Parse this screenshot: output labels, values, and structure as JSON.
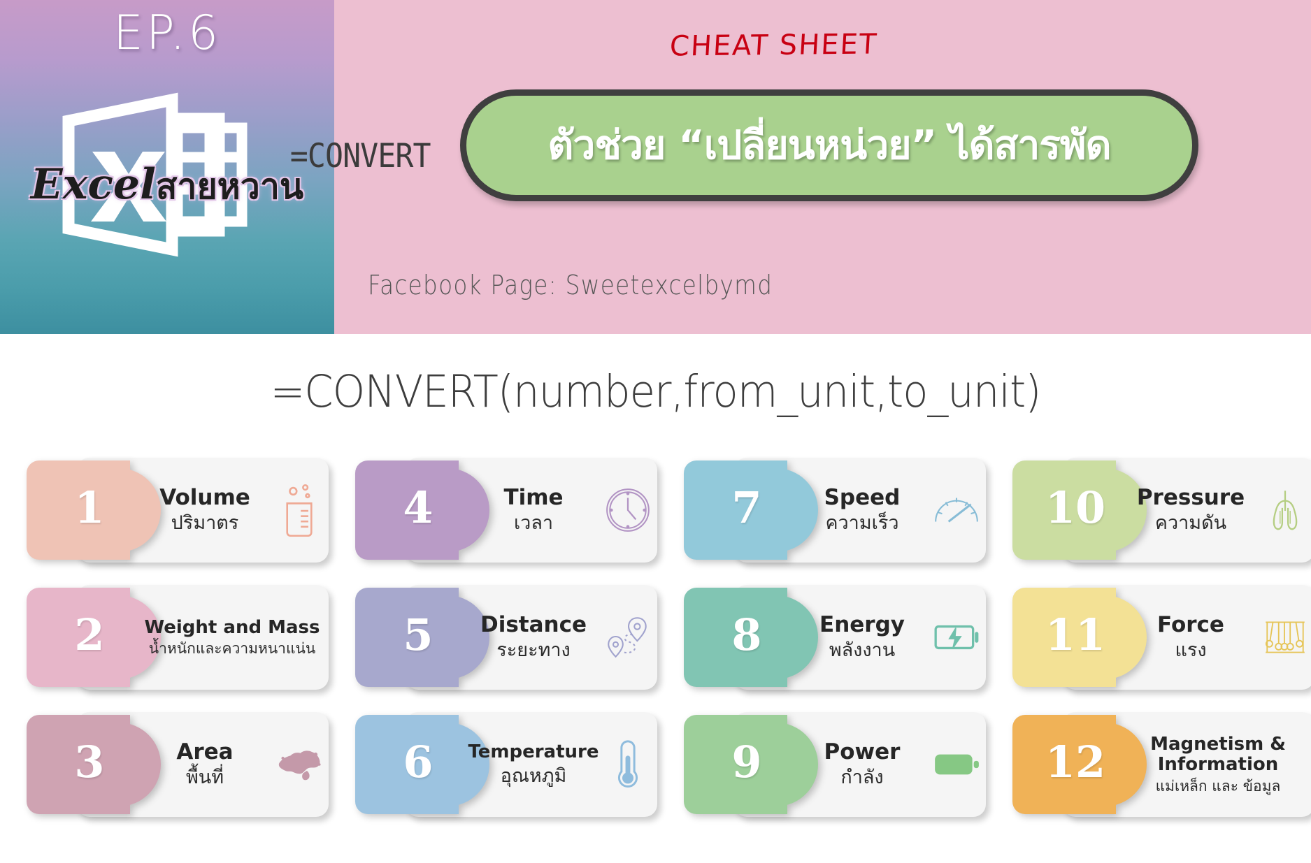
{
  "header": {
    "episode": "EP.6",
    "brand": "Excel",
    "brand_thai": "สายหวาน",
    "cheat_sheet": "CHEAT SHEET",
    "convert_label": "=CONVERT",
    "pill_text": "ตัวช่วย “เปลี่ยนหน่วย” ได้สารพัด",
    "facebook": "Facebook Page: Sweetexcelbymd",
    "colors": {
      "header_pink": "#edbfd1",
      "pill_green": "#a9d18e",
      "pill_outline": "#3f3f3f",
      "cheat_red": "#c80012"
    }
  },
  "formula": "=CONVERT(number,from_unit,to_unit)",
  "cards": [
    {
      "number": "1",
      "en": "Volume",
      "th": "ปริมาตร",
      "icon": "beaker-icon",
      "color": "#efc3b5"
    },
    {
      "number": "2",
      "en": "Weight and Mass",
      "th": "น้ำหนักและความหนาแน่น",
      "icon": "scale-icon",
      "color": "#e7b6c9"
    },
    {
      "number": "3",
      "en": "Area",
      "th": "พื้นที่",
      "icon": "map-icon",
      "color": "#cfa3b2"
    },
    {
      "number": "4",
      "en": "Time",
      "th": "เวลา",
      "icon": "clock-icon",
      "color": "#b99bc6"
    },
    {
      "number": "5",
      "en": "Distance",
      "th": "ระยะทาง",
      "icon": "route-pin-icon",
      "color": "#a7a8cd"
    },
    {
      "number": "6",
      "en": "Temperature",
      "th": "อุณหภูมิ",
      "icon": "thermometer-icon",
      "color": "#9cc3e0"
    },
    {
      "number": "7",
      "en": "Speed",
      "th": "ความเร็ว",
      "icon": "speedometer-icon",
      "color": "#92c9da"
    },
    {
      "number": "8",
      "en": "Energy",
      "th": "พลังงาน",
      "icon": "battery-bolt-icon",
      "color": "#81c5b3"
    },
    {
      "number": "9",
      "en": "Power",
      "th": "กำลัง",
      "icon": "battery-icon",
      "color": "#9dcf9a"
    },
    {
      "number": "10",
      "en": "Pressure",
      "th": "ความดัน",
      "icon": "lungs-icon",
      "color": "#cbdda1"
    },
    {
      "number": "11",
      "en": "Force",
      "th": "แรง",
      "icon": "newton-cradle-icon",
      "color": "#f3e195"
    },
    {
      "number": "12",
      "en": "Magnetism & Information",
      "th": "แม่เหล็ก และ ข้อมูล",
      "icon": "magnet-icon",
      "color": "#f0b257"
    }
  ]
}
